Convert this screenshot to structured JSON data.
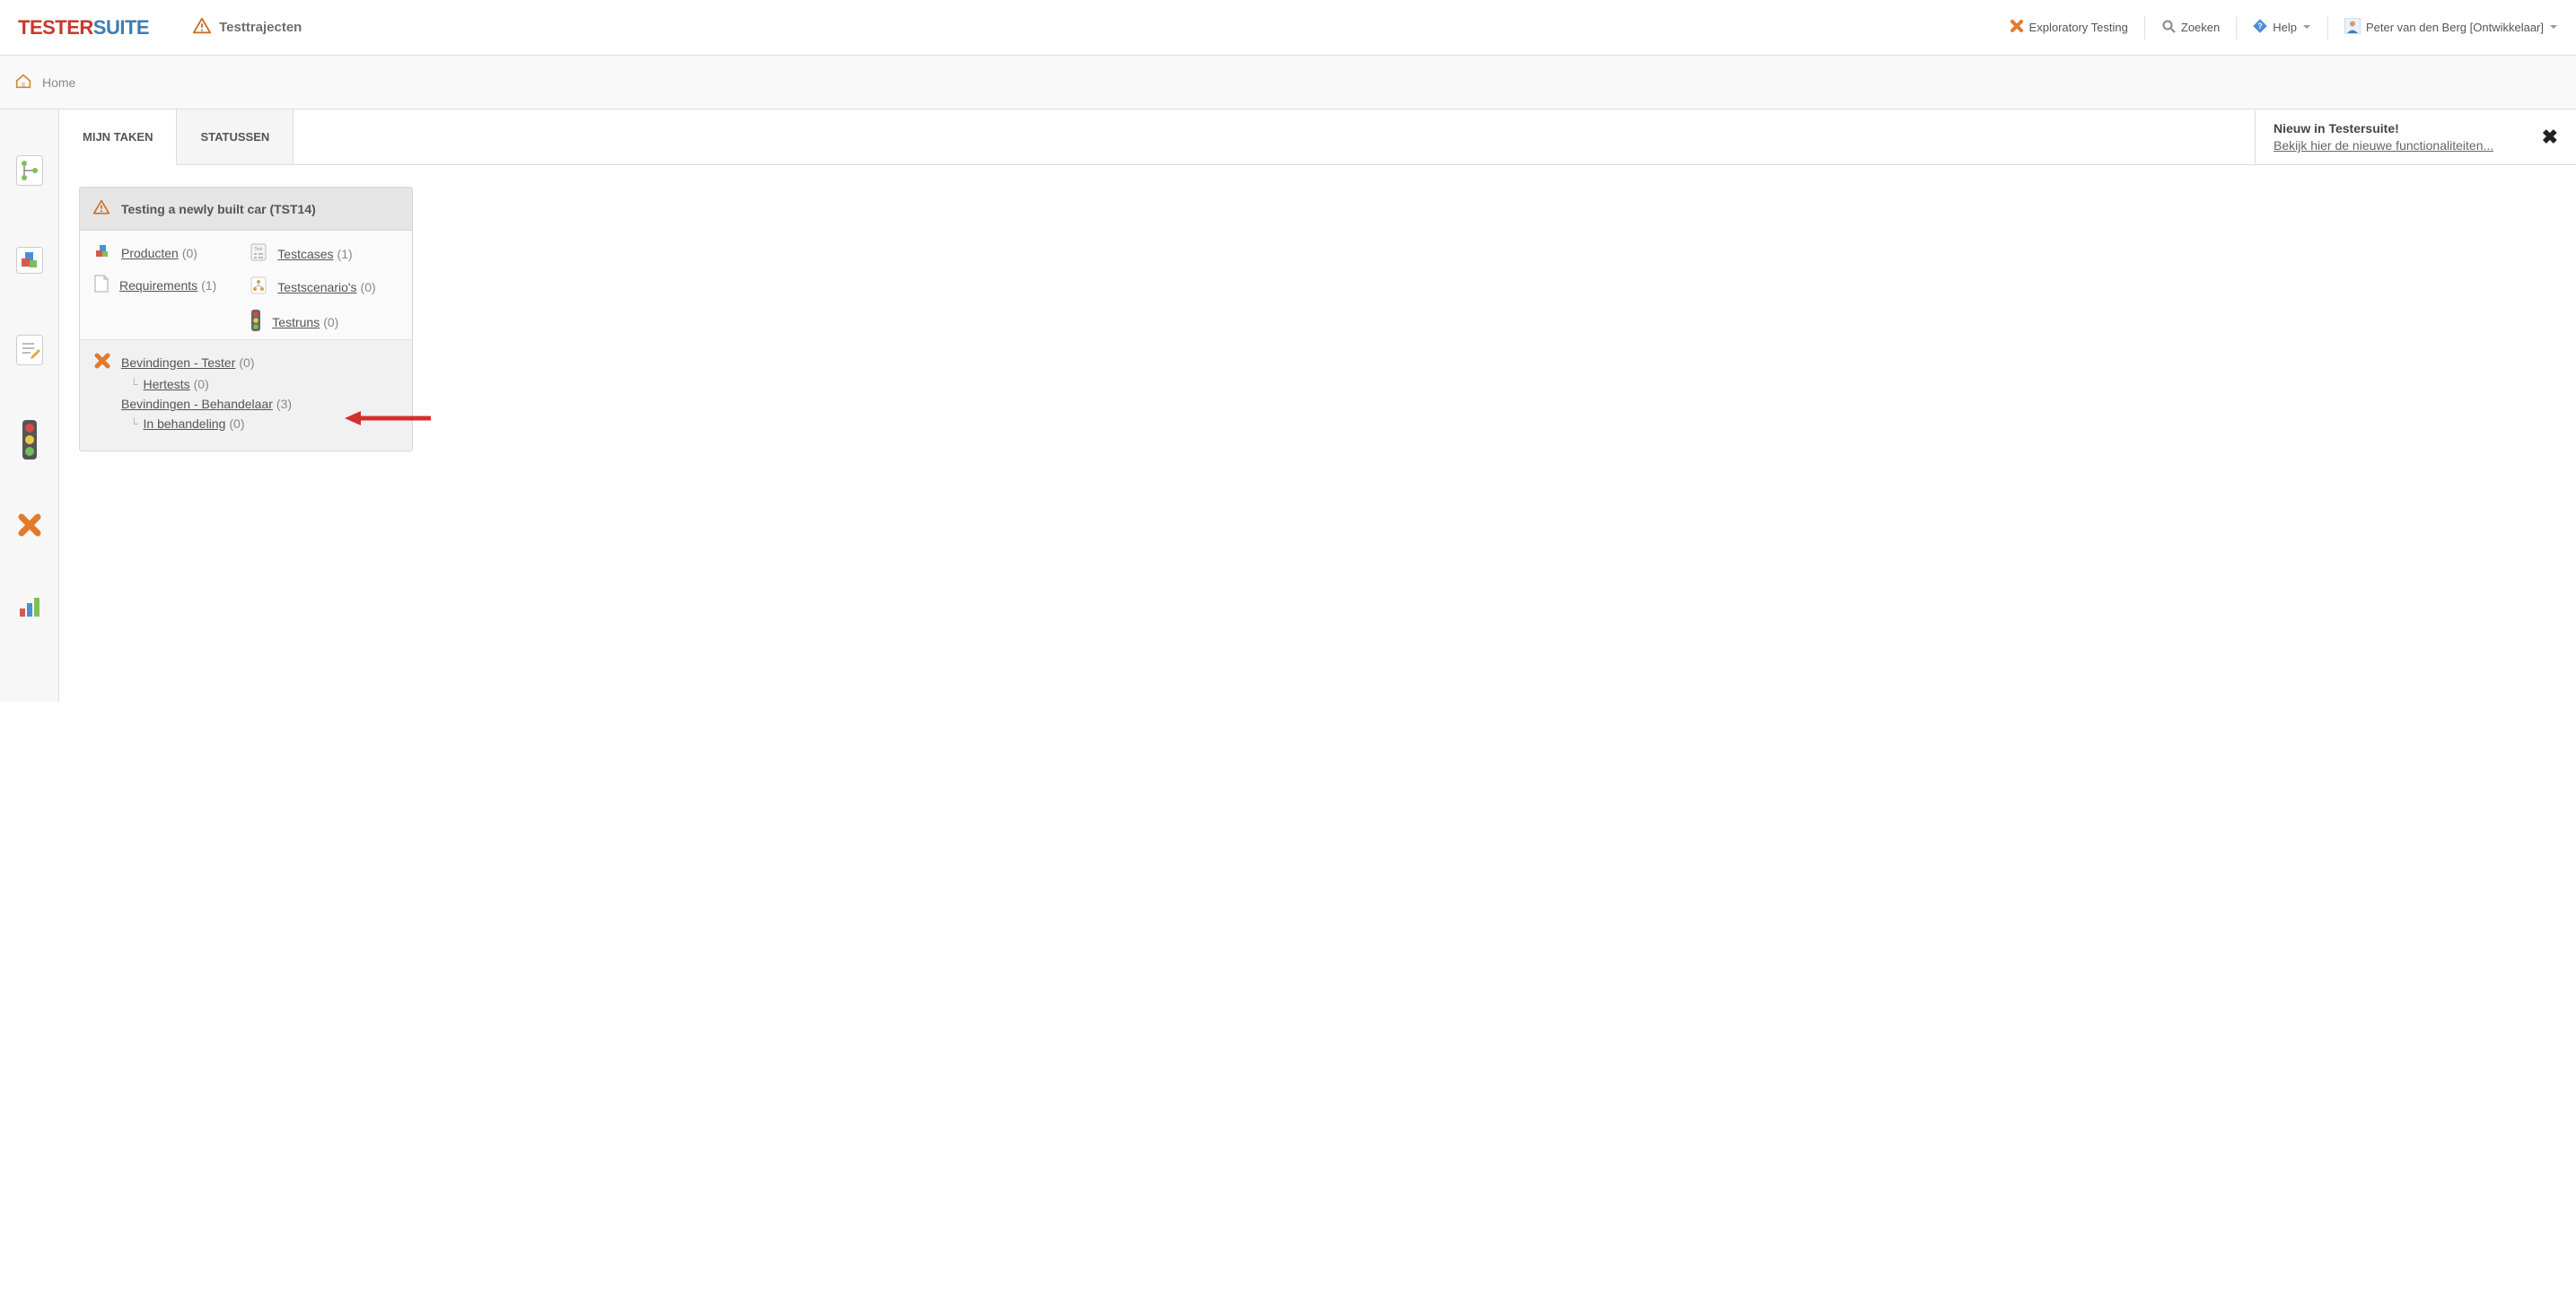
{
  "logo": {
    "part1": "TESTER",
    "part2": "SUITE"
  },
  "header": {
    "section_label": "Testtrajecten",
    "exploratory": "Exploratory Testing",
    "search": "Zoeken",
    "help": "Help",
    "user": "Peter van den Berg [Ontwikkelaar]"
  },
  "breadcrumb": {
    "home": "Home"
  },
  "tabs": {
    "my_tasks": "MIJN TAKEN",
    "statuses": "STATUSSEN"
  },
  "notice": {
    "title": "Nieuw in Testersuite!",
    "link": "Bekijk hier de nieuwe functionaliteiten..."
  },
  "panel": {
    "title": "Testing a newly built car (TST14)",
    "producten": {
      "label": "Producten",
      "count": "(0)"
    },
    "requirements": {
      "label": "Requirements",
      "count": "(1)"
    },
    "testcases": {
      "label": "Testcases",
      "count": "(1)"
    },
    "testscenarios": {
      "label": "Testscenario's",
      "count": "(0)"
    },
    "testruns": {
      "label": "Testruns",
      "count": "(0)"
    },
    "bevindingen_tester": {
      "label": "Bevindingen - Tester",
      "count": "(0)"
    },
    "hertests": {
      "label": "Hertests",
      "count": "(0)"
    },
    "bevindingen_behandelaar": {
      "label": "Bevindingen - Behandelaar",
      "count": "(3)"
    },
    "in_behandeling": {
      "label": "In behandeling",
      "count": "(0)"
    }
  }
}
